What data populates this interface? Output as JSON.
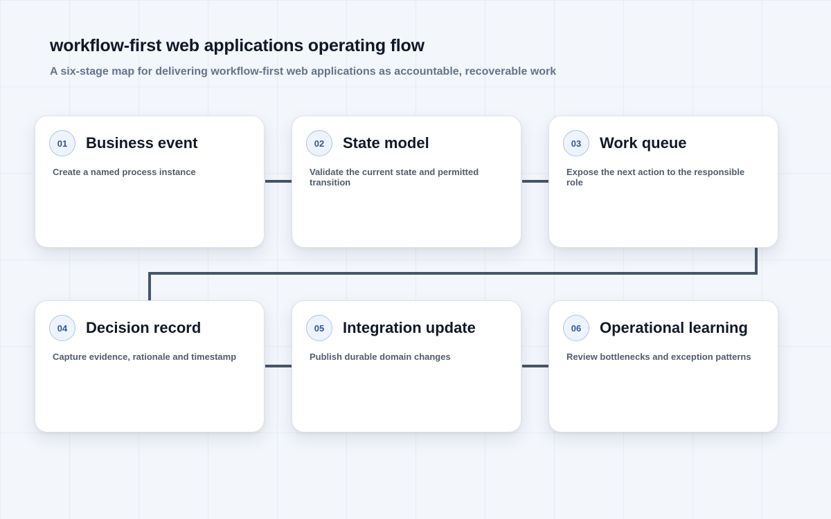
{
  "title": "workflow-first web applications operating flow",
  "subtitle": "A six-stage map for delivering workflow-first web applications as accountable, recoverable work",
  "colors": {
    "connector": "#475569",
    "badge_border": "#aac4ea",
    "badge_text": "#2f58a3",
    "background": "#f3f6fb"
  },
  "steps": [
    {
      "number": "01",
      "title": "Business event",
      "description": "Create a named process instance"
    },
    {
      "number": "02",
      "title": "State model",
      "description": "Validate the current state and permitted transition"
    },
    {
      "number": "03",
      "title": "Work queue",
      "description": "Expose the next action to the responsible role"
    },
    {
      "number": "04",
      "title": "Decision record",
      "description": "Capture evidence, rationale and timestamp"
    },
    {
      "number": "05",
      "title": "Integration update",
      "description": "Publish durable domain changes"
    },
    {
      "number": "06",
      "title": "Operational learning",
      "description": "Review bottlenecks and exception patterns"
    }
  ]
}
